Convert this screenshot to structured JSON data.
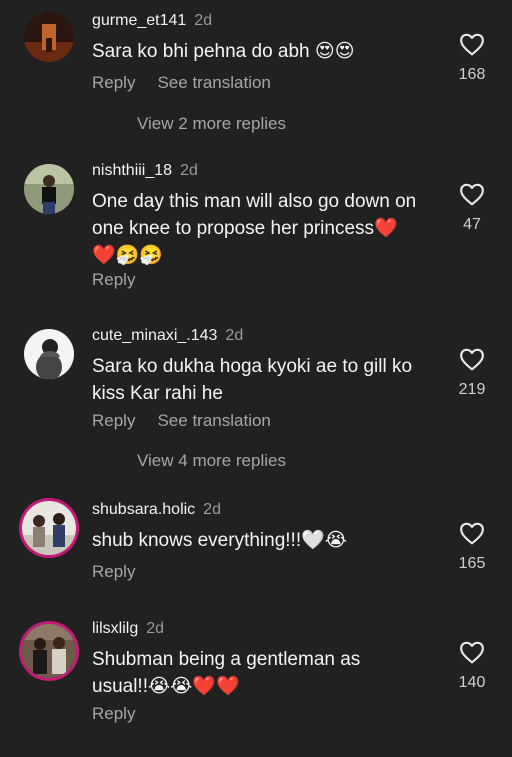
{
  "comments": [
    {
      "username": "gurme_et141",
      "time": "2d",
      "lines": [
        "Sara ko bhi pehna do abh 😍😍"
      ],
      "reply": "Reply",
      "translate": "See translation",
      "likes": "168",
      "more_replies": "View 2 more replies"
    },
    {
      "username": "nishthiii_18",
      "time": "2d",
      "lines": [
        "One day this man will also go down on",
        "one knee to propose her princess❤️",
        "❤️🤧🤧"
      ],
      "reply": "Reply",
      "likes": "47"
    },
    {
      "username": "cute_minaxi_.143",
      "time": "2d",
      "lines": [
        "Sara ko dukha hoga kyoki ae to gill ko",
        "kiss Kar rahi he"
      ],
      "reply": "Reply",
      "translate": "See translation",
      "likes": "219",
      "more_replies": "View 4 more replies"
    },
    {
      "username": "shubsara.holic",
      "time": "2d",
      "lines": [
        "shub knows everything!!!🤍😭"
      ],
      "reply": "Reply",
      "likes": "165"
    },
    {
      "username": "lilsxlilg",
      "time": "2d",
      "lines": [
        "Shubman being a gentleman as",
        "usual!!😭😭❤️❤️"
      ],
      "reply": "Reply",
      "likes": "140"
    }
  ],
  "icons": {
    "like": "heart-outline-icon"
  },
  "colors": {
    "background": "#212121",
    "story_ring": "#c21b7a",
    "muted_text": "#a6a6a6"
  }
}
